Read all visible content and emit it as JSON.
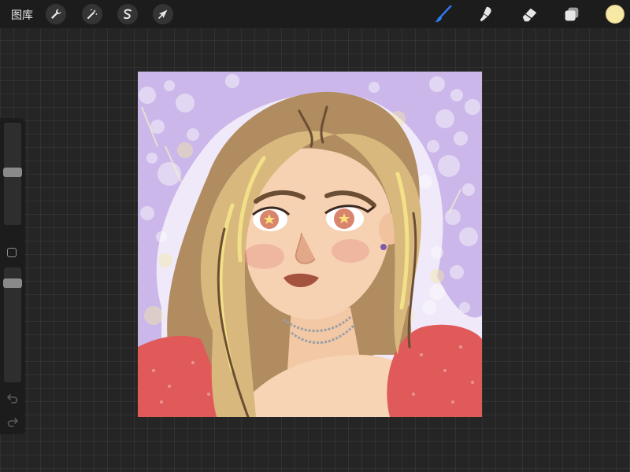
{
  "topbar": {
    "gallery_label": "图库",
    "tools_left": [
      {
        "name": "actions",
        "icon": "wrench-icon"
      },
      {
        "name": "adjustments",
        "icon": "magic-wand-icon"
      },
      {
        "name": "selection",
        "icon": "selection-s-icon"
      },
      {
        "name": "transform",
        "icon": "arrow-cursor-icon"
      }
    ],
    "tools_right": [
      {
        "name": "brush",
        "icon": "brush-icon",
        "active": true,
        "color": "#2f7bf6"
      },
      {
        "name": "smudge",
        "icon": "smudge-icon",
        "active": false
      },
      {
        "name": "eraser",
        "icon": "eraser-icon",
        "active": false
      },
      {
        "name": "layers",
        "icon": "layers-icon",
        "active": false
      }
    ],
    "current_color": "#f7e8a6"
  },
  "sidebar": {
    "brush_size": 0.47,
    "opacity": 0.9,
    "modifier_icon": "square-modifier-icon",
    "undo_icon": "undo-icon",
    "redo_icon": "redo-icon"
  },
  "canvas": {
    "background_color": "#cbb7ea",
    "artwork": "portrait-illustration"
  }
}
